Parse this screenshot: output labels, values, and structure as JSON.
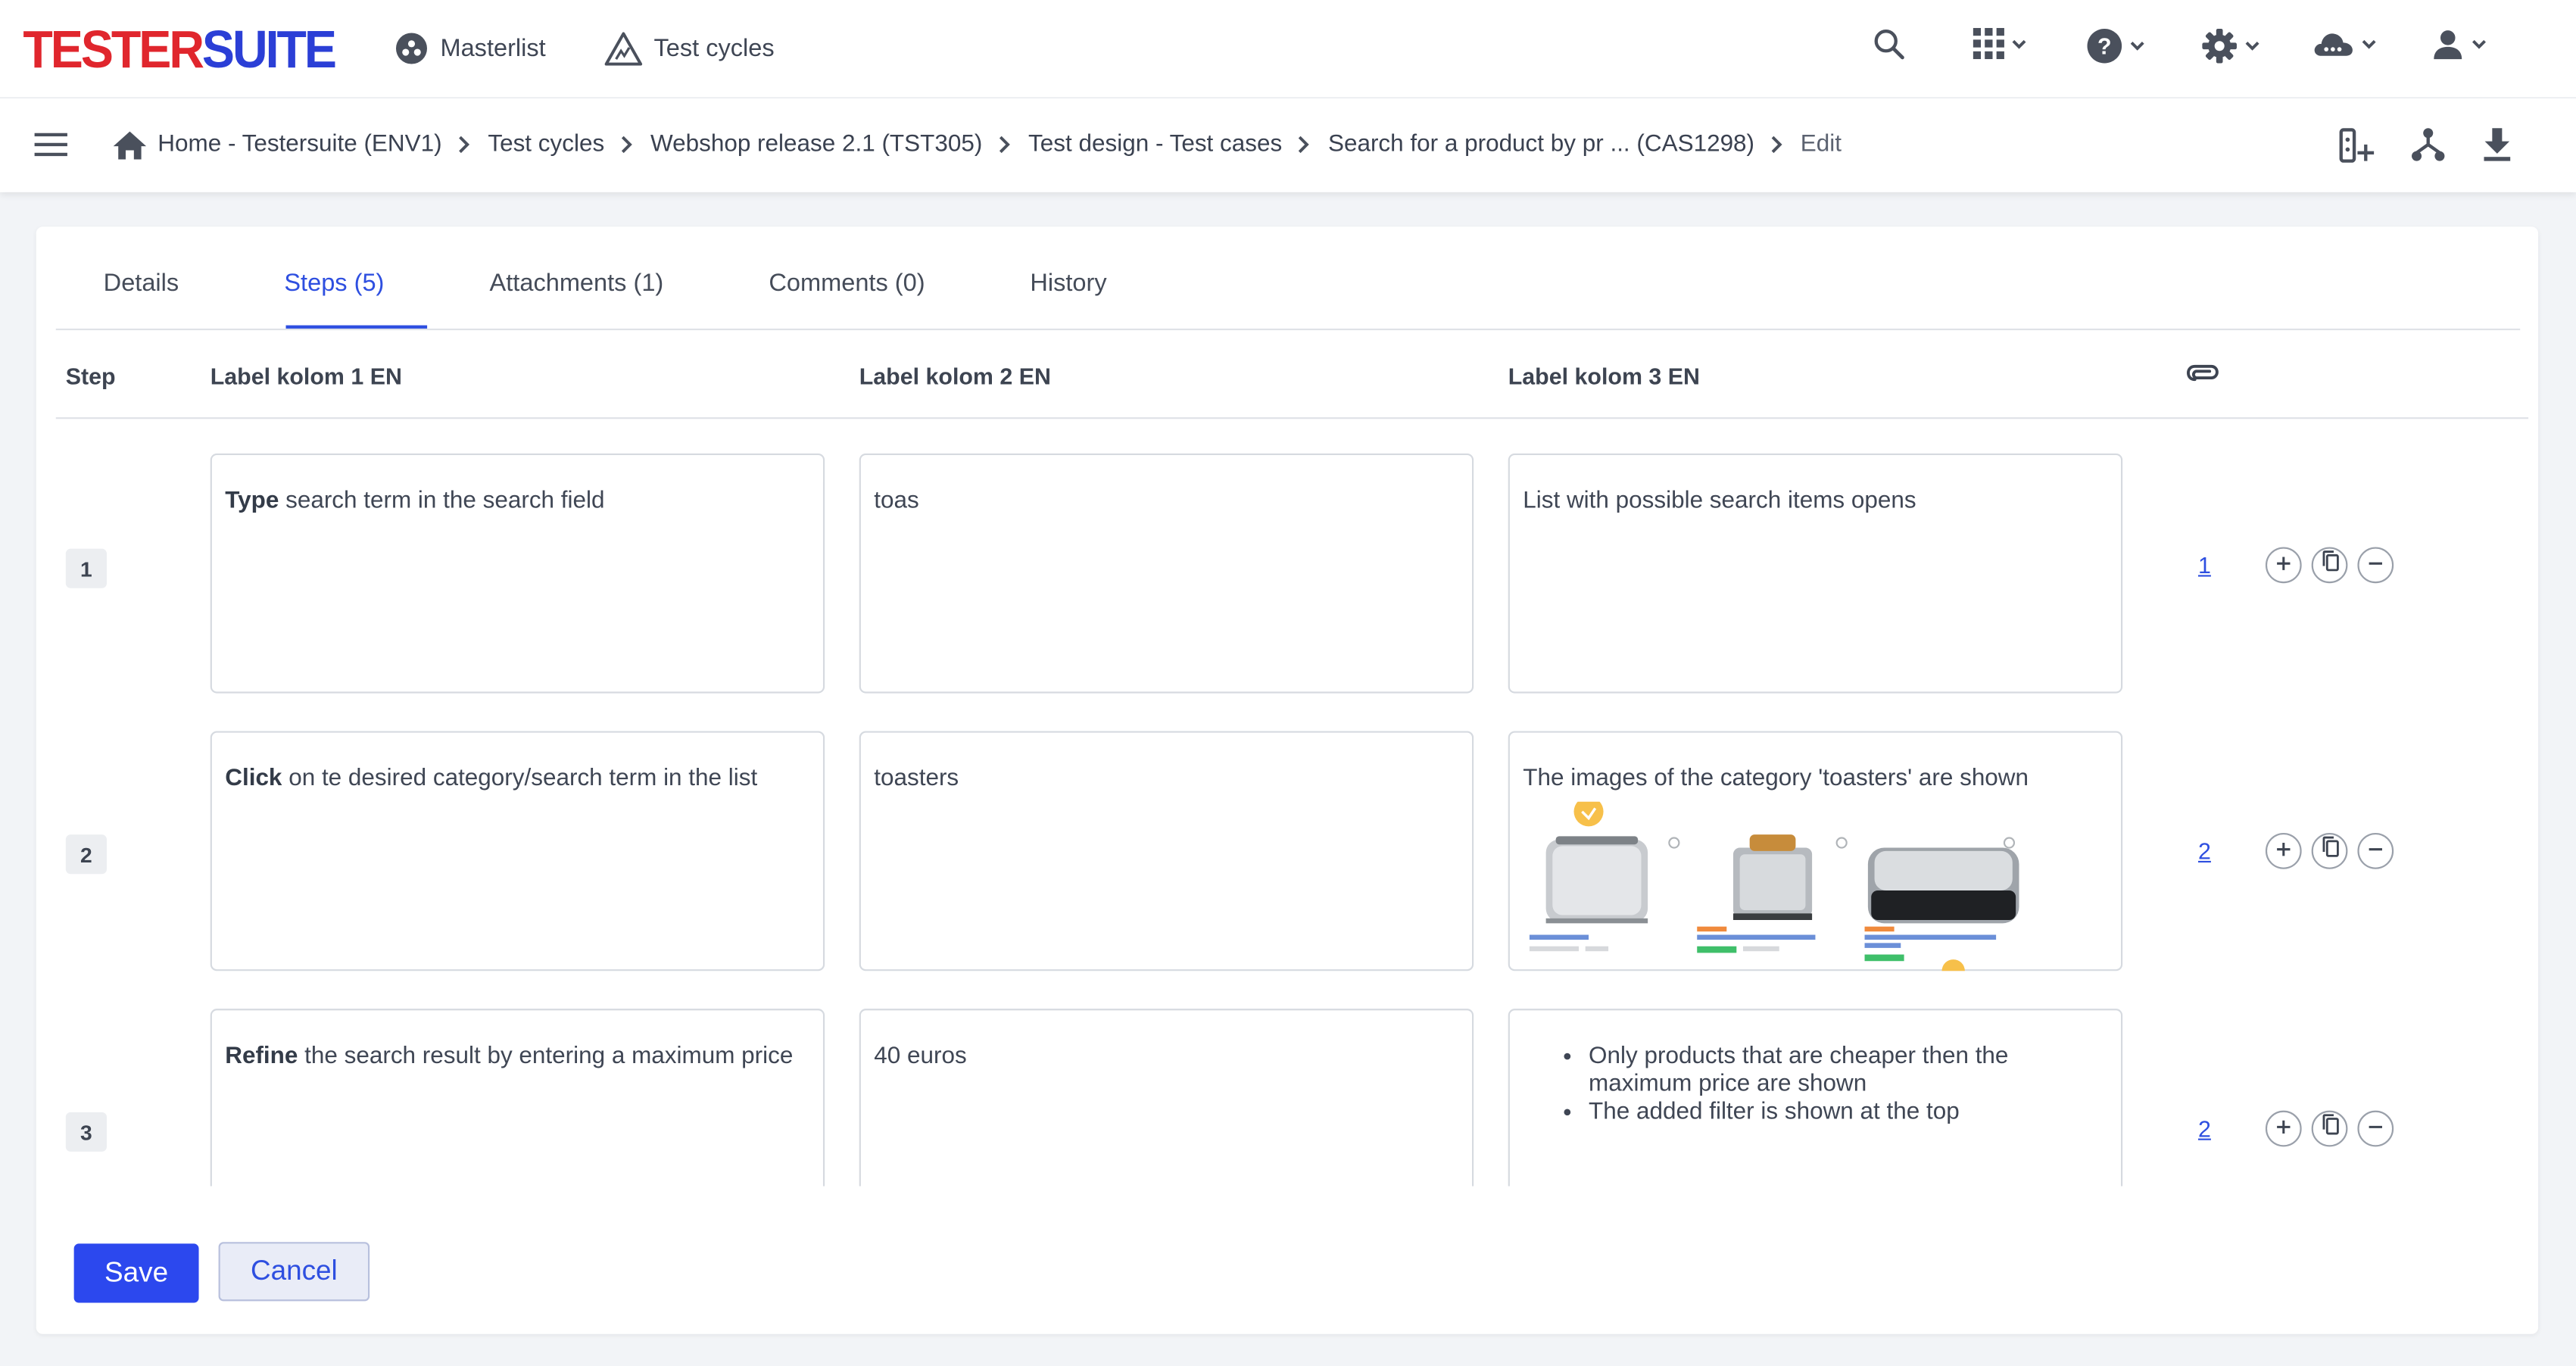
{
  "app": {
    "logo_part1": "TESTER",
    "logo_part2": "SUITE",
    "nav": [
      {
        "label": "Masterlist",
        "icon": "masterlist-icon"
      },
      {
        "label": "Test cycles",
        "icon": "test-cycles-icon"
      }
    ],
    "toolbar_icons": [
      "search-icon",
      "apps-grid-icon",
      "help-icon",
      "settings-icon",
      "cloud-icon",
      "user-icon"
    ]
  },
  "breadcrumb": [
    "Home - Testersuite (ENV1)",
    "Test cycles",
    "Webshop release 2.1 (TST305)",
    "Test design - Test cases",
    "Search for a product by pr ... (CAS1298)",
    "Edit"
  ],
  "page_actions": [
    "add-item-icon",
    "hierarchy-icon",
    "download-icon"
  ],
  "tabs": [
    {
      "label": "Details",
      "active": false
    },
    {
      "label": "Steps (5)",
      "active": true
    },
    {
      "label": "Attachments (1)",
      "active": false
    },
    {
      "label": "Comments (0)",
      "active": false
    },
    {
      "label": "History",
      "active": false
    }
  ],
  "columns": {
    "step": "Step",
    "col1": "Label kolom 1 EN",
    "col2": "Label kolom 2 EN",
    "col3": "Label kolom 3 EN",
    "attachments_icon": "paperclip-icon"
  },
  "steps": [
    {
      "number": "1",
      "action_bold": "Type",
      "action_rest": " search term in the search field",
      "input": "toas",
      "expected": "List with possible search items opens",
      "attachments": "1"
    },
    {
      "number": "2",
      "action_bold": "Click",
      "action_rest": " on te desired category/search term in the list",
      "input": "toasters",
      "expected": "The images of the category 'toasters' are shown",
      "attachments": "2"
    },
    {
      "number": "3",
      "action_bold": "Refine",
      "action_rest": " the search result by entering a maximum price",
      "input": "40 euros",
      "expected_list": [
        "Only products that are cheaper then the maximum price are shown",
        "The added filter is shown at the top"
      ],
      "attachments": "2"
    }
  ],
  "buttons": {
    "save": "Save",
    "cancel": "Cancel"
  },
  "colors": {
    "accent": "#2e4fe0",
    "logo_red": "#e0262d",
    "logo_blue": "#2b3fd6",
    "save_button": "#2c48ee"
  }
}
